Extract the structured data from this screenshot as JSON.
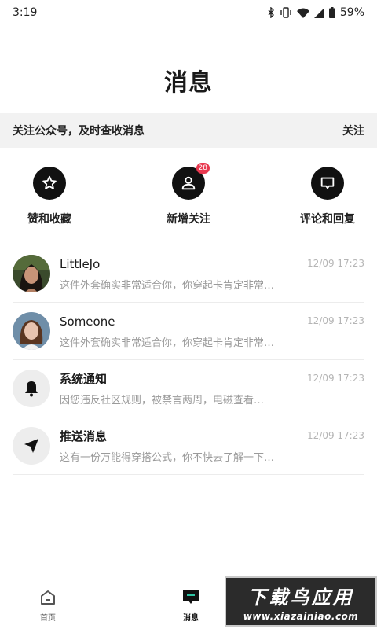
{
  "status_bar": {
    "time": "3:19",
    "battery": "59%"
  },
  "page_title": "消息",
  "follow_banner": {
    "text": "关注公众号，及时查收消息",
    "action": "关注"
  },
  "quick_actions": [
    {
      "label": "赞和收藏",
      "icon": "star-icon"
    },
    {
      "label": "新增关注",
      "icon": "person-icon",
      "badge": "28"
    },
    {
      "label": "评论和回复",
      "icon": "comment-icon"
    }
  ],
  "messages": [
    {
      "name": "LittleJo",
      "preview": "这件外套确实非常适合你，你穿起卡肯定非常…",
      "time": "12/09 17:23",
      "avatar": "photo"
    },
    {
      "name": "Someone",
      "preview": "这件外套确实非常适合你，你穿起卡肯定非常…",
      "time": "12/09 17:23",
      "avatar": "photo"
    },
    {
      "name": "系统通知",
      "preview": "因您违反社区规则，被禁言两周，电磁查看…",
      "time": "12/09 17:23",
      "avatar": "bell-icon"
    },
    {
      "name": "推送消息",
      "preview": "这有一份万能得穿搭公式，你不快去了解一下…",
      "time": "12/09 17:23",
      "avatar": "send-icon"
    }
  ],
  "tab_bar": {
    "home_label": "首页",
    "messages_label": "消息"
  },
  "watermark": {
    "title": "下载鸟应用",
    "url": "www.xiazainiao.com"
  }
}
